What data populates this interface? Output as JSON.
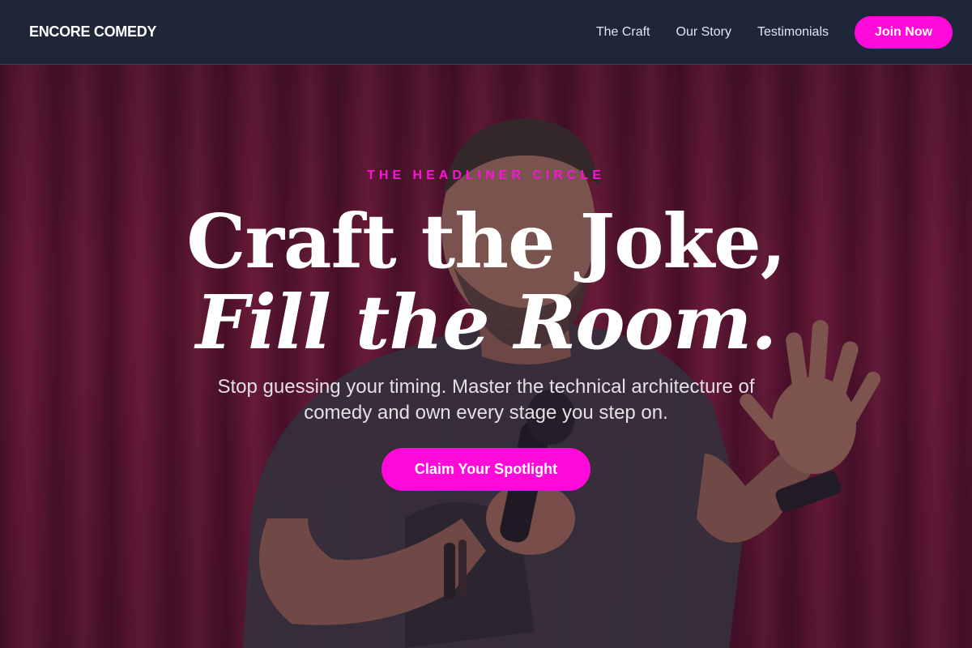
{
  "header": {
    "logo": "ENCORE COMEDY",
    "nav": [
      {
        "label": "The Craft"
      },
      {
        "label": "Our Story"
      },
      {
        "label": "Testimonials"
      }
    ],
    "cta_label": "Join Now"
  },
  "hero": {
    "eyebrow": "THE HEADLINER CIRCLE",
    "headline_line1": "Craft the Joke,",
    "headline_line2": "Fill the Room.",
    "subtext": "Stop guessing your timing. Master the technical architecture of comedy and own every stage you step on.",
    "cta_label": "Claim Your Spotlight",
    "background_image": "comedian-on-stage-with-microphone"
  },
  "colors": {
    "accent": "#ff0ad8",
    "header_bg": "#1f2639",
    "curtain": "#7a1838"
  }
}
